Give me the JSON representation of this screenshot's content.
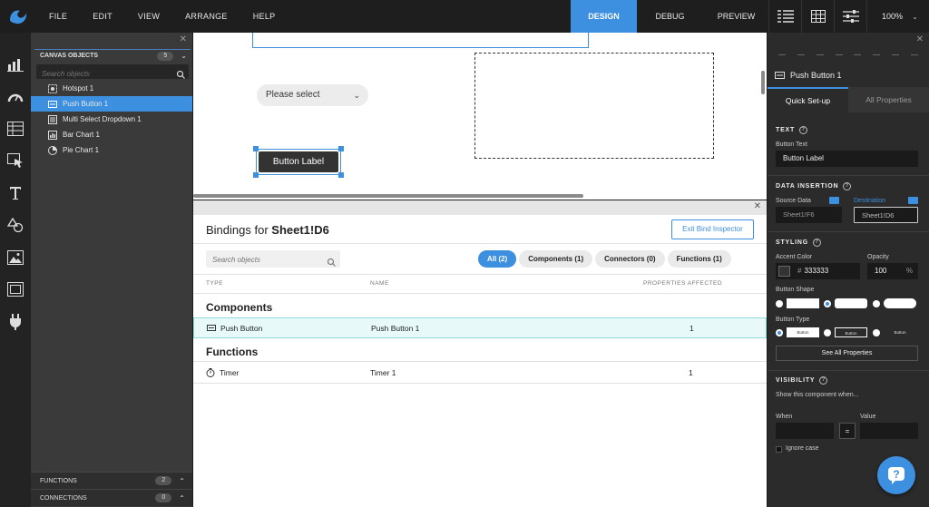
{
  "menu": [
    "FILE",
    "EDIT",
    "VIEW",
    "ARRANGE",
    "HELP"
  ],
  "modes": [
    "DESIGN",
    "DEBUG",
    "PREVIEW"
  ],
  "zoom": "100%",
  "canvas_objects": {
    "title": "CANVAS OBJECTS",
    "count": "5",
    "search_placeholder": "Search objects",
    "items": [
      {
        "label": "Hotspot 1",
        "icon": "hotspot-icon"
      },
      {
        "label": "Push Button 1",
        "icon": "button-icon"
      },
      {
        "label": "Multi Select Dropdown 1",
        "icon": "list-icon"
      },
      {
        "label": "Bar Chart 1",
        "icon": "bar-chart-icon"
      },
      {
        "label": "Pie Chart 1",
        "icon": "pie-chart-icon"
      }
    ]
  },
  "functions": {
    "label": "FUNCTIONS",
    "count": "2"
  },
  "connections": {
    "label": "CONNECTIONS",
    "count": "0"
  },
  "canvas": {
    "select_label": "Please select",
    "button_label": "Button Label"
  },
  "bindings": {
    "title_prefix": "Bindings for",
    "title_cell": "Sheet1!D6",
    "exit_label": "Exit Bind Inspector",
    "search_placeholder": "Search objects",
    "filters": [
      "All (2)",
      "Components (1)",
      "Connectors (0)",
      "Functions (1)"
    ],
    "columns": [
      "TYPE",
      "NAME",
      "PROPERTIES AFFECTED"
    ],
    "components_title": "Components",
    "components_rows": [
      {
        "type": "Push Button",
        "name": "Push Button 1",
        "props": "1"
      }
    ],
    "functions_title": "Functions",
    "functions_rows": [
      {
        "type": "Timer",
        "name": "Timer 1",
        "props": "1"
      }
    ]
  },
  "properties": {
    "component_name": "Push Button 1",
    "tabs": [
      "Quick Set-up",
      "All Properties"
    ],
    "text_section": "TEXT",
    "button_text_label": "Button Text",
    "button_text_value": "Button Label",
    "data_insertion_section": "DATA INSERTION",
    "source_label": "Source Data",
    "source_value": "Sheet1!F6",
    "destination_label": "Destination",
    "destination_value": "Sheet1!D6",
    "styling_section": "STYLING",
    "accent_label": "Accent Color",
    "accent_hash": "#",
    "accent_value": "333333",
    "opacity_label": "Opacity",
    "opacity_value": "100",
    "opacity_unit": "%",
    "shape_label": "Button Shape",
    "type_label": "Button Type",
    "type_options": [
      "Button",
      "Button",
      "Button"
    ],
    "see_all": "See All Properties",
    "visibility_section": "VISIBILITY",
    "show_when": "Show this component when...",
    "when_label": "When",
    "value_label": "Value",
    "equals": "=",
    "ignore_case": "Ignore case"
  },
  "colors": {
    "accent": "#3d8fe0",
    "topbar": "#1e1e1e",
    "panel": "#3a3a3a"
  }
}
